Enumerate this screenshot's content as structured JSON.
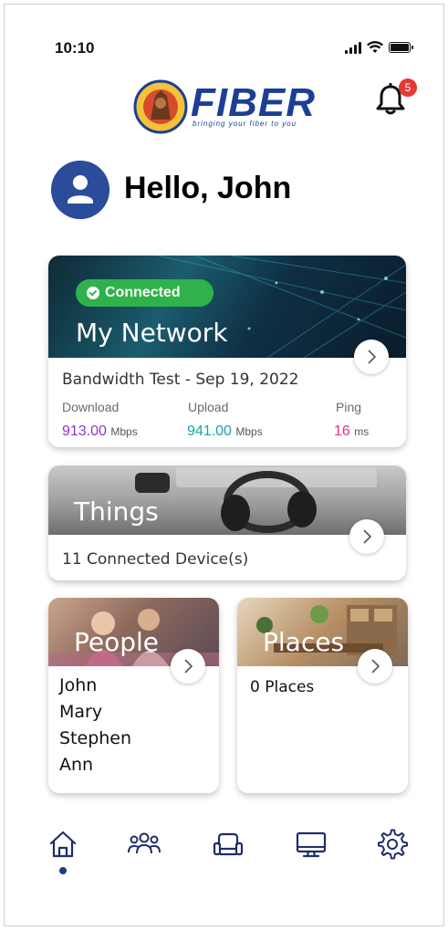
{
  "status_bar": {
    "time": "10:10"
  },
  "brand": {
    "name": "FIBER",
    "tagline": "bringing your fiber to you",
    "colors": {
      "primary": "#1b3f93",
      "accent": "#2fb24a",
      "badge": "#e53935"
    }
  },
  "notifications": {
    "icon": "bell-icon",
    "count": "5"
  },
  "greeting": {
    "text": "Hello, John",
    "avatar_icon": "user-avatar-icon"
  },
  "network_card": {
    "status": "Connected",
    "title": "My Network",
    "bandwidth_title": "Bandwidth Test - Sep 19, 2022",
    "download": {
      "label": "Download",
      "value": "913.00",
      "unit": "Mbps",
      "color": "#8e35c9"
    },
    "upload": {
      "label": "Upload",
      "value": "941.00",
      "unit": "Mbps",
      "color": "#1aa1a7"
    },
    "ping": {
      "label": "Ping",
      "value": "16",
      "unit": "ms",
      "color": "#e0338d"
    }
  },
  "things_card": {
    "title": "Things",
    "subtitle": "11 Connected Device(s)"
  },
  "people_card": {
    "title": "People",
    "names": [
      "John",
      "Mary",
      "Stephen",
      "Ann"
    ]
  },
  "places_card": {
    "title": "Places",
    "subtitle": "0 Places"
  },
  "tab_bar": {
    "active": "home",
    "items": [
      {
        "id": "home",
        "icon": "home-icon"
      },
      {
        "id": "people",
        "icon": "people-icon"
      },
      {
        "id": "places",
        "icon": "sofa-icon"
      },
      {
        "id": "devices",
        "icon": "monitor-icon"
      },
      {
        "id": "settings",
        "icon": "gear-icon"
      }
    ]
  }
}
